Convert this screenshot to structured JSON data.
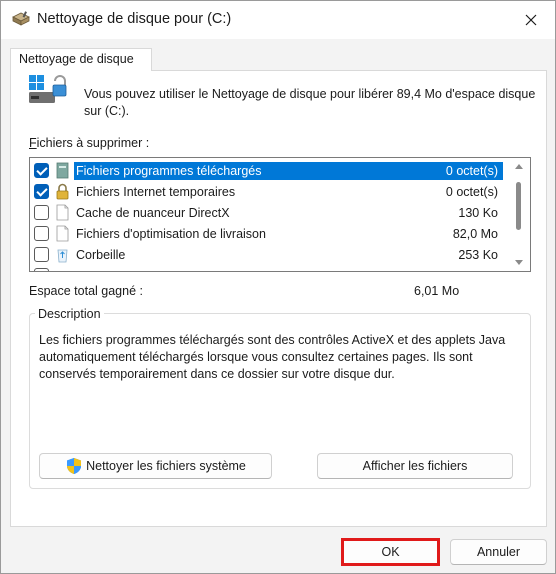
{
  "window": {
    "title": "Nettoyage de disque pour  (C:)",
    "tab_label": "Nettoyage de disque",
    "intro_text": "Vous pouvez utiliser le Nettoyage de disque pour libérer 89,4 Mo d'espace disque sur  (C:)."
  },
  "files": {
    "label_prefix": "F",
    "label_rest": "ichiers à supprimer :",
    "items": [
      {
        "name": "Fichiers programmes téléchargés",
        "size": "0 octet(s)",
        "checked": true,
        "selected": true,
        "icon": "folder-icon"
      },
      {
        "name": "Fichiers Internet temporaires",
        "size": "0 octet(s)",
        "checked": true,
        "selected": false,
        "icon": "lock-icon"
      },
      {
        "name": "Cache de nuanceur DirectX",
        "size": "130 Ko",
        "checked": false,
        "selected": false,
        "icon": "file-icon"
      },
      {
        "name": "Fichiers d'optimisation de livraison",
        "size": "82,0 Mo",
        "checked": false,
        "selected": false,
        "icon": "file-icon"
      },
      {
        "name": "Corbeille",
        "size": "253 Ko",
        "checked": false,
        "selected": false,
        "icon": "recycle-bin-icon"
      }
    ]
  },
  "space": {
    "label": "Espace total gagné :",
    "value": "6,01 Mo"
  },
  "description": {
    "title": "Description",
    "text": "Les fichiers programmes téléchargés sont des contrôles ActiveX et des applets Java automatiquement téléchargés lorsque vous consultez certaines pages. Ils sont conservés temporairement dans ce dossier sur votre disque dur."
  },
  "buttons": {
    "clean_system": "Nettoyer les fichiers système",
    "show_files": "Afficher les fichiers",
    "ok": "OK",
    "cancel": "Annuler"
  },
  "colors": {
    "selection": "#0078d7",
    "checkbox_checked": "#005fb8",
    "ok_highlight": "#e01a1a"
  }
}
